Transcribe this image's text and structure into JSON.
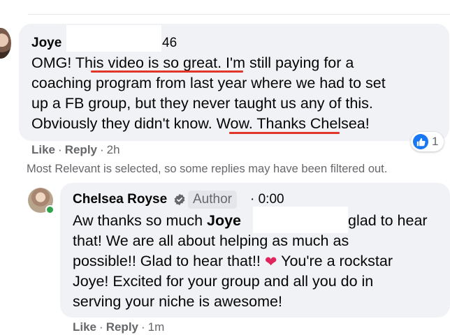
{
  "top_comment": {
    "author": "Joye",
    "author_suffix": "46",
    "lines": [
      "OMG! This video is so great. I'm still paying for a",
      "coaching program from last year where we had to set",
      "up a FB group, but they never taught us any of this.",
      "Obviously they didn't know. Wow. Thanks Chelsea!"
    ],
    "reaction_count": "1",
    "actions": {
      "like": "Like",
      "reply": "Reply",
      "time": "2h"
    }
  },
  "filter_note": "Most Relevant is selected, so some replies may have been filtered out.",
  "reply": {
    "author": "Chelsea Royse",
    "badge": "Author",
    "meta": "· 0:00",
    "line1_prefix": "Aw thanks so much ",
    "line1_mention": "Joye",
    "line1_suffix": "glad to hear",
    "lines": [
      "that! We are all about helping as much as",
      "possible!! Glad to hear that!!",
      "You're a rockstar",
      "Joye! Excited for your group and all you do in",
      "serving your niche is awesome!"
    ],
    "actions": {
      "like": "Like",
      "reply": "Reply",
      "time": "1m"
    }
  },
  "icons": {
    "verified": "verified-badge-icon",
    "like": "thumbs-up-icon",
    "heart": "red-heart-emoji"
  },
  "colors": {
    "bubble": "#f0f2f5",
    "secondary_text": "#65676b",
    "facebook_blue": "#1877f2",
    "underline_red": "#e1372b",
    "online_green": "#31a24c"
  }
}
